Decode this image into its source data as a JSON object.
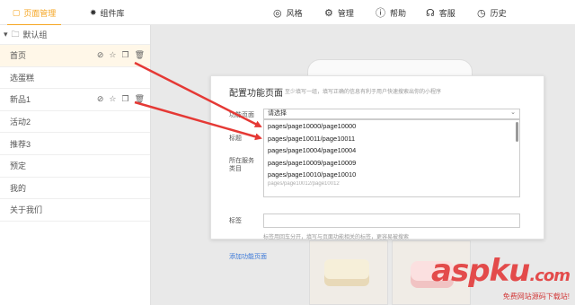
{
  "tabs": {
    "page_manage": "页面管理",
    "component_lib": "组件库"
  },
  "nav": [
    {
      "icon": "eye-icon",
      "label": "风格"
    },
    {
      "icon": "gear-icon",
      "label": "管理"
    },
    {
      "icon": "help-icon",
      "label": "帮助"
    },
    {
      "icon": "headset-icon",
      "label": "客服"
    },
    {
      "icon": "clock-icon",
      "label": "历史"
    }
  ],
  "sidebar": {
    "group_label": "默认组",
    "items": [
      {
        "label": "首页",
        "active": true,
        "actions": true
      },
      {
        "label": "选蛋糕",
        "active": false,
        "actions": false
      },
      {
        "label": "新品1",
        "active": false,
        "actions": true
      },
      {
        "label": "活动2",
        "active": false,
        "actions": false
      },
      {
        "label": "推荐3",
        "active": false,
        "actions": false
      },
      {
        "label": "预定",
        "active": false,
        "actions": false
      },
      {
        "label": "我的",
        "active": false,
        "actions": false
      },
      {
        "label": "关于我们",
        "active": false,
        "actions": false
      }
    ]
  },
  "dialog": {
    "title": "配置功能页面",
    "hint": "至少填写一组，填写正确的信息有利于用户快速搜索出你的小程序",
    "label_page": "功能页面",
    "label_title": "标题",
    "label_category": "所在服务类目",
    "label_tags": "标签",
    "select_value": "请选择",
    "options": [
      "pages/page10000/page10000",
      "pages/page10011/page10011",
      "pages/page10004/page10004",
      "pages/page10009/page10009",
      "pages/page10010/page10010"
    ],
    "option_partial": "pages/page10012/page10012",
    "tags_help": "标签用回车分开，填写与页面功能相关的标签，更容易被搜索",
    "add_link": "添加功能页面"
  },
  "colors": {
    "accent": "#f5a623",
    "arrow": "#e53935",
    "link": "#3a78d8"
  },
  "watermark": {
    "logo": "aspku",
    "logo_suffix": ".com",
    "sub": "免费网站源码下载站!"
  }
}
